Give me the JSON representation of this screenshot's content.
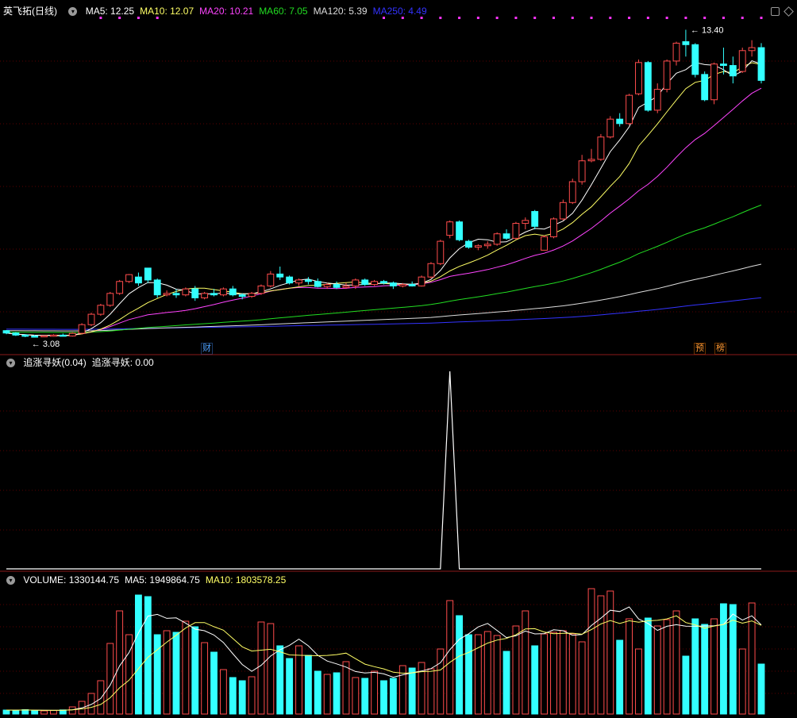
{
  "stock": {
    "name": "英飞拓",
    "period": "日线"
  },
  "legend_price": [
    {
      "label": "MA5: 12.25",
      "color": "#ffffff"
    },
    {
      "label": "MA10: 12.07",
      "color": "#ffff66"
    },
    {
      "label": "MA20: 10.21",
      "color": "#ff44ff"
    },
    {
      "label": "MA60: 7.05",
      "color": "#22dd22"
    },
    {
      "label": "MA120: 5.39",
      "color": "#dddddd"
    },
    {
      "label": "MA250: 4.49",
      "color": "#3333ff"
    }
  ],
  "legend_ind": [
    {
      "label": "追涨寻妖(0.04)",
      "color": "#ffffff"
    },
    {
      "label": "追涨寻妖: 0.00",
      "color": "#ffffff"
    }
  ],
  "legend_vol": [
    {
      "label": "VOLUME: 1330144.75",
      "color": "#ffffff"
    },
    {
      "label": "MA5: 1949864.75",
      "color": "#ffffff"
    },
    {
      "label": "MA10: 1803578.25",
      "color": "#ffff66"
    }
  ],
  "tags": {
    "cai": "财",
    "yu": "预",
    "bang": "榜"
  },
  "colors": {
    "up": "#ff4c4c",
    "down": "#33ffff",
    "bg": "#000000",
    "grid": "#5a0000",
    "dots": "#ff33ff"
  },
  "chart_data": [
    {
      "type": "candlestick",
      "title": "英飞拓(日线)",
      "annotations": [
        {
          "label": "3.08",
          "type": "low"
        },
        {
          "label": "13.40",
          "type": "high"
        }
      ],
      "ohlc": [
        [
          3.3,
          3.32,
          3.18,
          3.22
        ],
        [
          3.22,
          3.25,
          3.12,
          3.15
        ],
        [
          3.15,
          3.18,
          3.08,
          3.12
        ],
        [
          3.12,
          3.16,
          3.09,
          3.1
        ],
        [
          3.1,
          3.14,
          3.08,
          3.13
        ],
        [
          3.13,
          3.18,
          3.1,
          3.15
        ],
        [
          3.15,
          3.2,
          3.11,
          3.12
        ],
        [
          3.12,
          3.25,
          3.1,
          3.21
        ],
        [
          3.21,
          3.55,
          3.18,
          3.5
        ],
        [
          3.5,
          3.9,
          3.45,
          3.85
        ],
        [
          3.85,
          4.2,
          3.8,
          4.15
        ],
        [
          4.15,
          4.6,
          4.1,
          4.55
        ],
        [
          4.55,
          5.0,
          4.5,
          4.95
        ],
        [
          4.95,
          5.2,
          4.9,
          5.18
        ],
        [
          5.1,
          5.25,
          4.8,
          4.9
        ],
        [
          5.4,
          5.4,
          4.9,
          5.0
        ],
        [
          5.0,
          5.05,
          4.4,
          4.5
        ],
        [
          4.5,
          4.65,
          4.45,
          4.55
        ],
        [
          4.55,
          4.7,
          4.4,
          4.5
        ],
        [
          4.5,
          4.75,
          4.45,
          4.7
        ],
        [
          4.7,
          4.8,
          4.3,
          4.4
        ],
        [
          4.4,
          4.6,
          4.35,
          4.55
        ],
        [
          4.55,
          4.7,
          4.45,
          4.5
        ],
        [
          4.5,
          4.75,
          4.45,
          4.7
        ],
        [
          4.7,
          4.8,
          4.45,
          4.5
        ],
        [
          4.5,
          4.55,
          4.35,
          4.45
        ],
        [
          4.45,
          4.6,
          4.4,
          4.55
        ],
        [
          4.55,
          4.85,
          4.5,
          4.8
        ],
        [
          4.8,
          5.3,
          4.75,
          5.2
        ],
        [
          5.2,
          5.45,
          5.0,
          5.1
        ],
        [
          5.1,
          5.15,
          4.85,
          4.9
        ],
        [
          4.9,
          5.05,
          4.8,
          5.0
        ],
        [
          5.0,
          5.1,
          4.85,
          4.95
        ],
        [
          4.95,
          5.05,
          4.75,
          4.78
        ],
        [
          4.78,
          4.9,
          4.7,
          4.85
        ],
        [
          4.85,
          4.95,
          4.7,
          4.75
        ],
        [
          4.75,
          4.9,
          4.7,
          4.8
        ],
        [
          4.8,
          5.05,
          4.7,
          5.0
        ],
        [
          5.0,
          5.05,
          4.8,
          4.85
        ],
        [
          4.85,
          5.0,
          4.8,
          4.95
        ],
        [
          4.95,
          5.0,
          4.85,
          4.9
        ],
        [
          4.9,
          4.95,
          4.7,
          4.8
        ],
        [
          4.8,
          4.9,
          4.75,
          4.85
        ],
        [
          4.85,
          4.95,
          4.78,
          4.8
        ],
        [
          4.8,
          5.15,
          4.78,
          5.1
        ],
        [
          5.1,
          5.6,
          5.05,
          5.55
        ],
        [
          5.55,
          6.35,
          5.5,
          6.3
        ],
        [
          6.5,
          7.0,
          6.4,
          6.95
        ],
        [
          6.95,
          7.0,
          6.3,
          6.35
        ],
        [
          6.3,
          6.35,
          6.05,
          6.1
        ],
        [
          6.1,
          6.2,
          6.0,
          6.15
        ],
        [
          6.15,
          6.3,
          6.05,
          6.2
        ],
        [
          6.2,
          6.6,
          6.15,
          6.55
        ],
        [
          6.55,
          6.7,
          6.35,
          6.4
        ],
        [
          6.4,
          6.95,
          6.35,
          6.9
        ],
        [
          6.9,
          7.1,
          6.7,
          7.0
        ],
        [
          7.3,
          7.35,
          6.7,
          6.8
        ],
        [
          6.0,
          6.5,
          6.0,
          6.45
        ],
        [
          6.45,
          7.1,
          6.4,
          7.05
        ],
        [
          7.05,
          7.7,
          7.0,
          7.6
        ],
        [
          7.6,
          8.4,
          7.55,
          8.3
        ],
        [
          8.3,
          9.2,
          8.2,
          9.0
        ],
        [
          9.0,
          9.4,
          8.95,
          9.05
        ],
        [
          9.05,
          9.9,
          9.0,
          9.8
        ],
        [
          9.8,
          10.5,
          9.75,
          10.4
        ],
        [
          10.4,
          10.6,
          10.15,
          10.25
        ],
        [
          10.25,
          11.25,
          10.2,
          11.2
        ],
        [
          11.25,
          12.4,
          11.2,
          12.3
        ],
        [
          12.3,
          12.35,
          10.65,
          10.7
        ],
        [
          10.7,
          11.6,
          10.6,
          11.4
        ],
        [
          11.4,
          12.4,
          11.3,
          12.35
        ],
        [
          12.35,
          13.0,
          12.2,
          12.95
        ],
        [
          13.0,
          13.4,
          12.5,
          12.9
        ],
        [
          12.9,
          12.95,
          11.8,
          11.9
        ],
        [
          11.9,
          12.0,
          11.0,
          11.05
        ],
        [
          11.05,
          12.3,
          10.9,
          12.25
        ],
        [
          12.25,
          12.8,
          11.9,
          12.2
        ],
        [
          12.2,
          12.5,
          11.6,
          11.85
        ],
        [
          12.0,
          12.8,
          11.95,
          12.7
        ],
        [
          12.7,
          13.05,
          12.5,
          12.8
        ],
        [
          12.8,
          12.95,
          11.6,
          11.7
        ]
      ],
      "ylim": [
        3.0,
        13.6
      ]
    },
    {
      "type": "line",
      "title": "追涨寻妖",
      "peak_index": 47,
      "values_peak": 1.0,
      "ylim": [
        0,
        1.0
      ]
    },
    {
      "type": "bar",
      "title": "VOLUME",
      "values": [
        50000,
        48000,
        55000,
        42000,
        40000,
        45000,
        52000,
        90000,
        160000,
        260000,
        420000,
        890000,
        1300000,
        1000000,
        1500000,
        1480000,
        1000000,
        1050000,
        1030000,
        1170000,
        1100000,
        900000,
        780000,
        560000,
        460000,
        420000,
        470000,
        1160000,
        1140000,
        860000,
        700000,
        860000,
        740000,
        540000,
        500000,
        520000,
        660000,
        460000,
        450000,
        540000,
        420000,
        450000,
        610000,
        580000,
        650000,
        570000,
        820000,
        1430000,
        1240000,
        1000000,
        1000000,
        1040000,
        990000,
        790000,
        1110000,
        1300000,
        860000,
        1010000,
        1030000,
        1050000,
        1010000,
        910000,
        1580000,
        1490000,
        1550000,
        930000,
        1200000,
        820000,
        1210000,
        1110000,
        1190000,
        1300000,
        730000,
        1200000,
        1130000,
        1200000,
        1390000,
        1380000,
        820000,
        1400000,
        630000
      ],
      "ylim": [
        0,
        1600000
      ]
    }
  ]
}
